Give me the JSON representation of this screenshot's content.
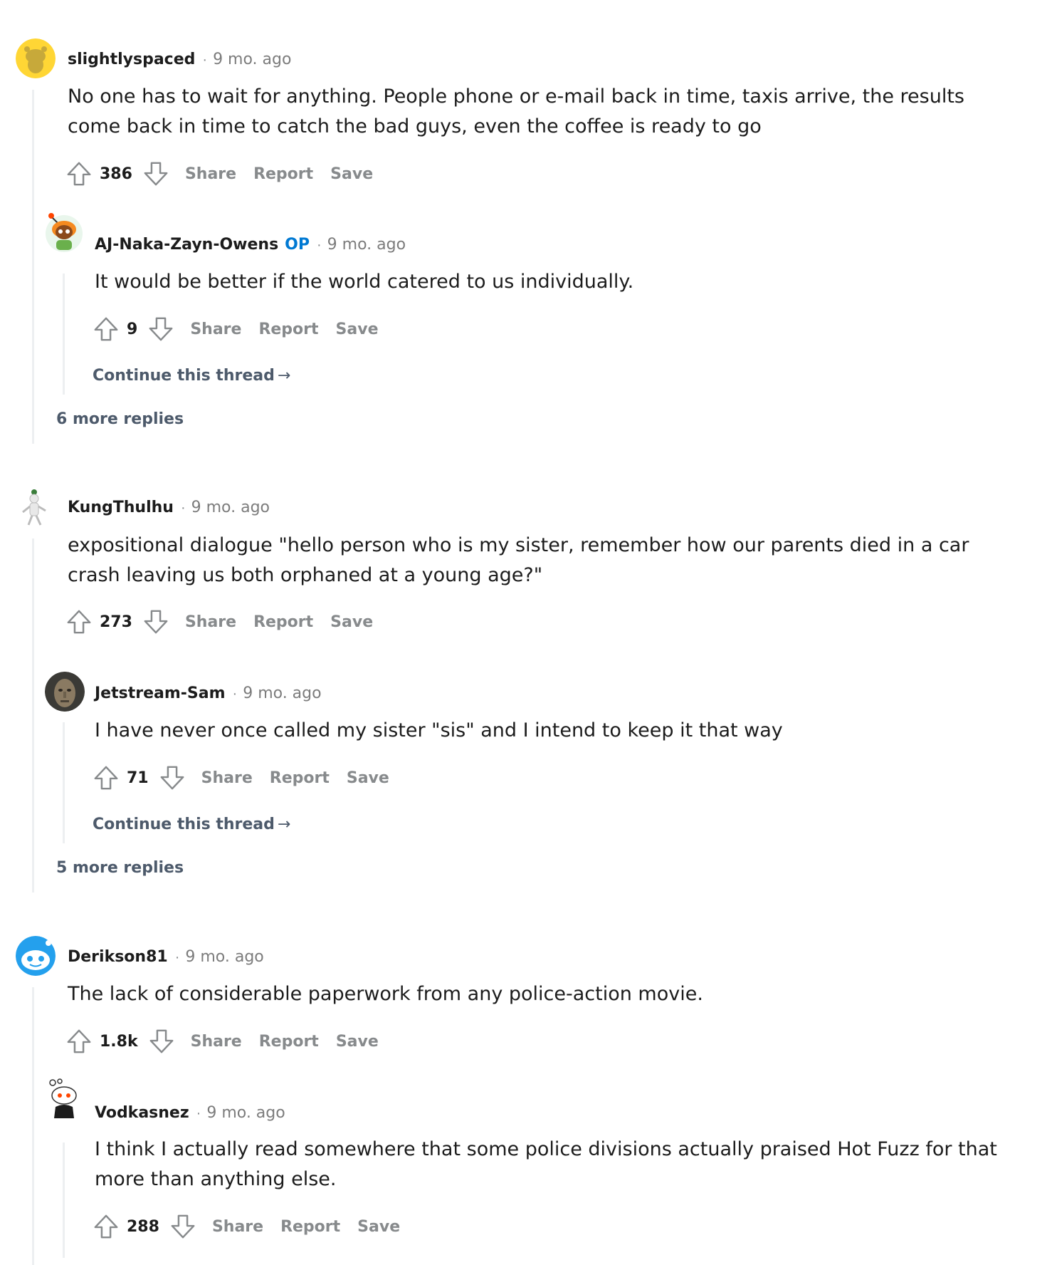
{
  "comments": [
    {
      "author": "slightlyspaced",
      "time": "9 mo. ago",
      "body": "No one has to wait for anything. People phone or e-mail back in time, taxis arrive, the results come back in time to catch the bad guys, even the coffee is ready to go",
      "score": "386",
      "actions": {
        "share": "Share",
        "report": "Report",
        "save": "Save"
      },
      "more_replies": "6 more replies",
      "reply": {
        "author": "AJ-Naka-Zayn-Owens",
        "op_badge": "OP",
        "time": "9 mo. ago",
        "body": "It would be better if the world catered to us individually.",
        "score": "9",
        "actions": {
          "share": "Share",
          "report": "Report",
          "save": "Save"
        },
        "continue": "Continue this thread"
      }
    },
    {
      "author": "KungThulhu",
      "time": "9 mo. ago",
      "body": "expositional dialogue \"hello person who is my sister, remember how our parents died in a car crash leaving us both orphaned at a young age?\"",
      "score": "273",
      "actions": {
        "share": "Share",
        "report": "Report",
        "save": "Save"
      },
      "more_replies": "5 more replies",
      "reply": {
        "author": "Jetstream-Sam",
        "time": "9 mo. ago",
        "body": "I have never once called my sister \"sis\" and I intend to keep it that way",
        "score": "71",
        "actions": {
          "share": "Share",
          "report": "Report",
          "save": "Save"
        },
        "continue": "Continue this thread"
      }
    },
    {
      "author": "Derikson81",
      "time": "9 mo. ago",
      "body": "The lack of considerable paperwork from any police-action movie.",
      "score": "1.8k",
      "actions": {
        "share": "Share",
        "report": "Report",
        "save": "Save"
      },
      "reply": {
        "author": "Vodkasnez",
        "time": "9 mo. ago",
        "body": "I think I actually read somewhere that some police divisions actually praised Hot Fuzz for that more than anything else.",
        "score": "288",
        "actions": {
          "share": "Share",
          "report": "Report",
          "save": "Save"
        }
      }
    }
  ],
  "meta": {
    "separator": "·",
    "arrow": "→"
  },
  "colors": {
    "op": "#0079d3",
    "muted": "#878a8c",
    "thread_line": "#edeff1",
    "link": "#4d5a6b"
  }
}
